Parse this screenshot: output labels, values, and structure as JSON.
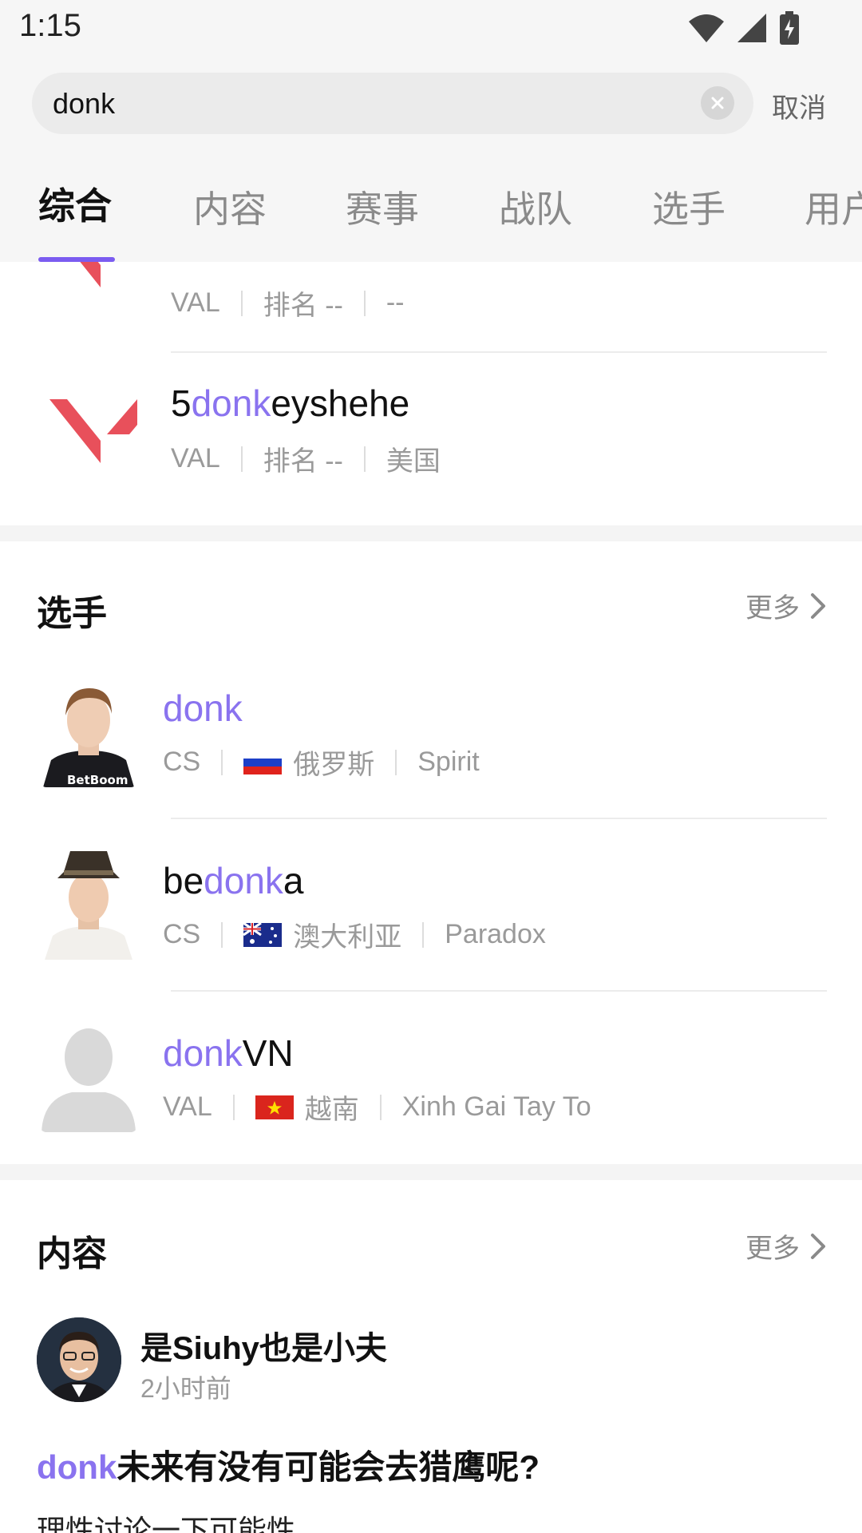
{
  "status": {
    "time": "1:15"
  },
  "search": {
    "query": "donk",
    "cancel": "取消"
  },
  "tabs": [
    "综合",
    "内容",
    "赛事",
    "战队",
    "选手",
    "用户"
  ],
  "teams": [
    {
      "name_pre": "",
      "name_hl": "",
      "name_post": "",
      "game": "VAL",
      "rank": "排名 --",
      "region": "--"
    },
    {
      "name_pre": "5",
      "name_hl": "donk",
      "name_post": "eyshehe",
      "game": "VAL",
      "rank": "排名 --",
      "region": "美国"
    }
  ],
  "players_section": {
    "title": "选手",
    "more": "更多"
  },
  "players": [
    {
      "name_pre": "",
      "name_hl": "donk",
      "name_post": "",
      "game": "CS",
      "country": "俄罗斯",
      "team": "Spirit",
      "flag": "russia"
    },
    {
      "name_pre": "be",
      "name_hl": "donk",
      "name_post": "a",
      "game": "CS",
      "country": "澳大利亚",
      "team": "Paradox",
      "flag": "australia"
    },
    {
      "name_pre": "",
      "name_hl": "donk",
      "name_post": "VN",
      "game": "VAL",
      "country": "越南",
      "team": "Xinh Gai Tay To",
      "flag": "vietnam"
    }
  ],
  "content_section": {
    "title": "内容",
    "more": "更多"
  },
  "post": {
    "author": "是Siuhy也是小夫",
    "time": "2小时前",
    "title_hl": "donk",
    "title_rest": "未来有没有可能会去猎鹰呢?",
    "body": "理性讨论一下可能性"
  },
  "colors": {
    "accent": "#7b5cf0",
    "highlight": "#8a73ef",
    "valorant_red": "#e8505b"
  },
  "icons": [
    "wifi-icon",
    "signal-icon",
    "battery-icon",
    "clear-icon",
    "chevron-right-icon",
    "valorant-logo"
  ]
}
